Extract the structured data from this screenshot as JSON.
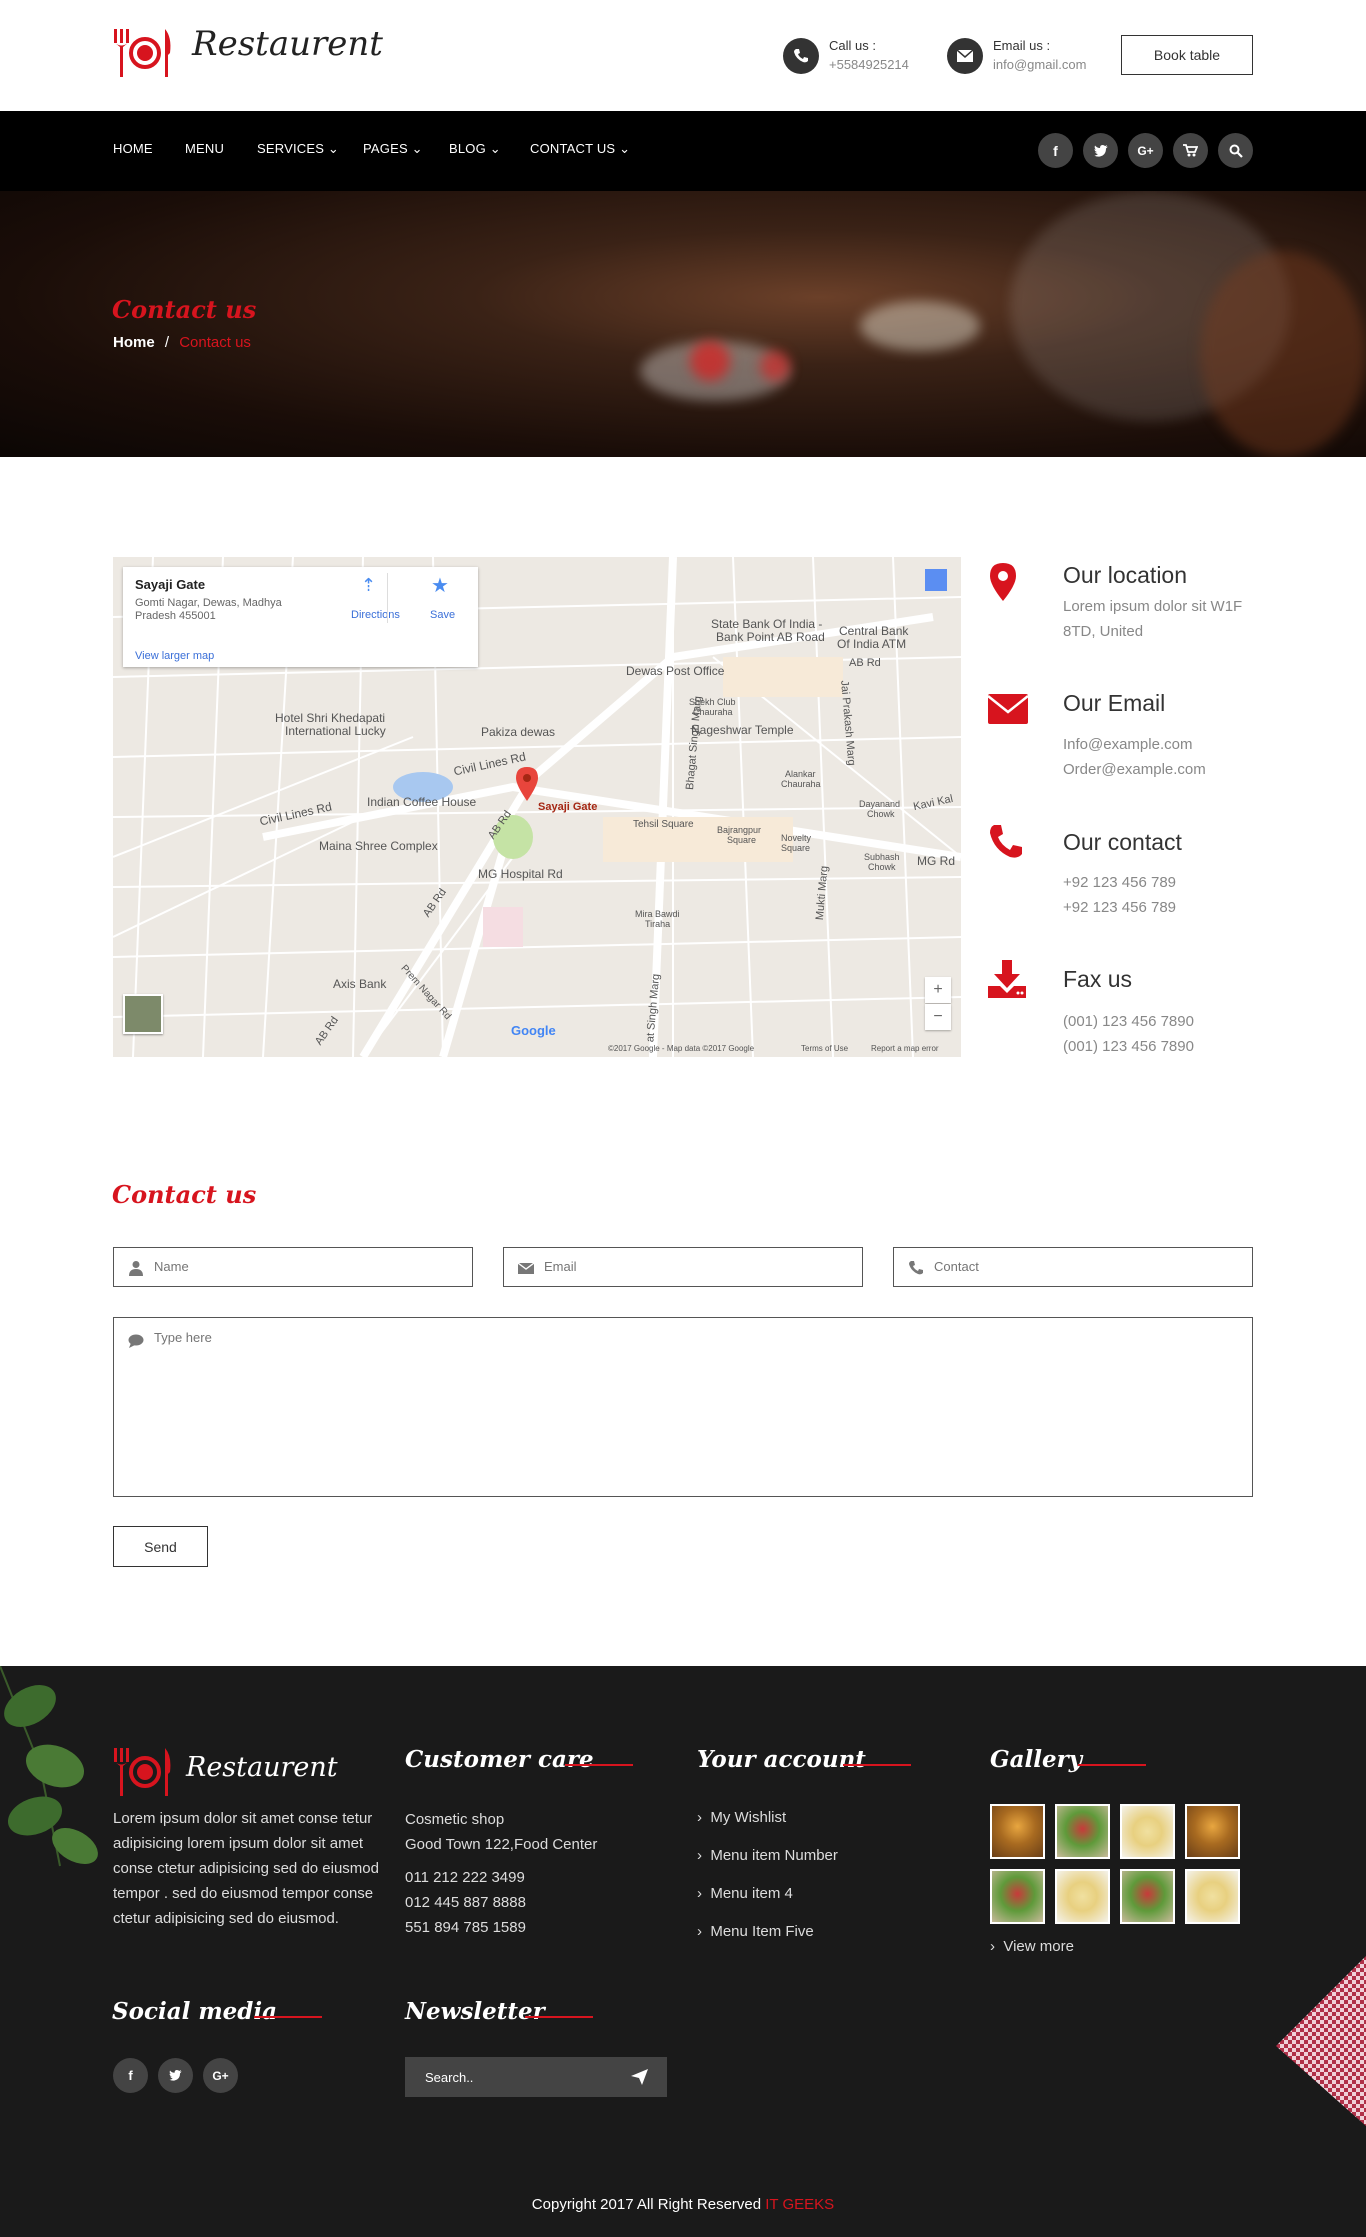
{
  "brand": {
    "name": "Restaurent",
    "accent": "#d7141e"
  },
  "header": {
    "call_label": "Call us :",
    "call_value": "+5584925214",
    "email_label": "Email us :",
    "email_value": "info@gmail.com",
    "book_label": "Book table"
  },
  "nav": {
    "items": [
      {
        "label": "HOME",
        "dropdown": false
      },
      {
        "label": "MENU",
        "dropdown": false
      },
      {
        "label": "SERVICES",
        "dropdown": true
      },
      {
        "label": "PAGES",
        "dropdown": true
      },
      {
        "label": "BLOG",
        "dropdown": true
      },
      {
        "label": "CONTACT US",
        "dropdown": true
      }
    ],
    "social": [
      "facebook-icon",
      "twitter-icon",
      "google-plus-icon",
      "cart-icon",
      "search-icon"
    ]
  },
  "hero": {
    "title": "Contact us",
    "crumb_home": "Home",
    "crumb_sep": "/",
    "crumb_current": "Contact us"
  },
  "map": {
    "place_name": "Sayaji Gate",
    "place_address_1": "Gomti Nagar, Dewas, Madhya",
    "place_address_2": "Pradesh 455001",
    "directions": "Directions",
    "save": "Save",
    "larger": "View larger map",
    "pin_label": "Sayaji Gate",
    "labels": {
      "sbi": "State Bank Of India -",
      "sbi2": "Bank Point AB Road",
      "cbi": "Central Bank",
      "cbi2": "Of India ATM",
      "abrd": "AB Rd",
      "post": "Dewas Post Office",
      "shekh": "Shekh Club",
      "shekh2": "Chauraha",
      "nageshwar": "Nageshwar Temple",
      "hotel": "Hotel Shri Khedapati",
      "hotel2": "International Lucky",
      "pakiza": "Pakiza dewas",
      "civil": "Civil Lines Rd",
      "civil2": "Civil Lines Rd",
      "coffee": "Indian Coffee House",
      "abrd2": "AB Rd",
      "maina": "Maina Shree Complex",
      "tehsil": "Tehsil Square",
      "bajrang": "Bajrangpur",
      "bajrang2": "Square",
      "novelty": "Novelty",
      "novelty2": "Square",
      "dayanand": "Dayanand",
      "dayanand2": "Chowk",
      "kavi": "Kavi Kal",
      "subhash": "Subhash",
      "subhash2": "Chowk",
      "mgrd": "MG Rd",
      "mghosp": "MG Hospital Rd",
      "abrd3": "AB Rd",
      "mira": "Mira Bawdi",
      "mira2": "Tiraha",
      "axis": "Axis Bank",
      "prem": "Prem Nagar Rd",
      "abrd4": "AB Rd",
      "bhagat": "Bhagat Singh Marg",
      "bhagat2": "at Singh Marg",
      "jai": "Jai Prakash Marg",
      "mukti": "Mukti Marg",
      "alankar": "Alankar",
      "alankar2": "Chauraha",
      "google": "Google",
      "attribution": "©2017 Google - Map data ©2017 Google",
      "terms": "Terms of Use",
      "report": "Report a map error"
    },
    "zoom_in": "+",
    "zoom_out": "−"
  },
  "info": [
    {
      "title": "Our location",
      "line1": "Lorem ipsum dolor sit W1F",
      "line2": "8TD, United",
      "icon": "location-pin-icon"
    },
    {
      "title": "Our Email",
      "line1": "Info@example.com",
      "line2": "Order@example.com",
      "icon": "envelope-icon"
    },
    {
      "title": "Our contact",
      "line1": "+92 123 456 789",
      "line2": "+92 123 456 789",
      "icon": "phone-icon"
    },
    {
      "title": "Fax us",
      "line1": "(001) 123 456 7890",
      "line2": "(001) 123 456 7890",
      "icon": "fax-download-icon"
    }
  ],
  "form": {
    "title": "Contact us",
    "name_placeholder": "Name",
    "email_placeholder": "Email",
    "contact_placeholder": "Contact",
    "message_placeholder": "Type here",
    "send_label": "Send"
  },
  "footer": {
    "about": "Lorem ipsum dolor sit amet conse tetur adipisicing lorem ipsum dolor sit amet conse ctetur adipisicing sed do eiusmod tempor . sed do eiusmod tempor conse ctetur adipisicing sed do eiusmod.",
    "care_title": "Customer care",
    "care_lines": [
      "Cosmetic shop",
      "Good Town 122,Food Center"
    ],
    "care_phones": [
      "011 212 222 3499",
      "012 445 887 8888",
      "551 894 785 1589"
    ],
    "account_title": "Your account",
    "account_links": [
      "My Wishlist",
      "Menu item Number",
      "Menu item 4",
      "Menu Item Five"
    ],
    "gallery_title": "Gallery",
    "view_more": "View more",
    "social_title": "Social media",
    "newsletter_title": "Newsletter",
    "newsletter_placeholder": "Search..",
    "copyright": "Copyright 2017 All Right Reserved",
    "copyright_brand": "IT GEEKS"
  }
}
